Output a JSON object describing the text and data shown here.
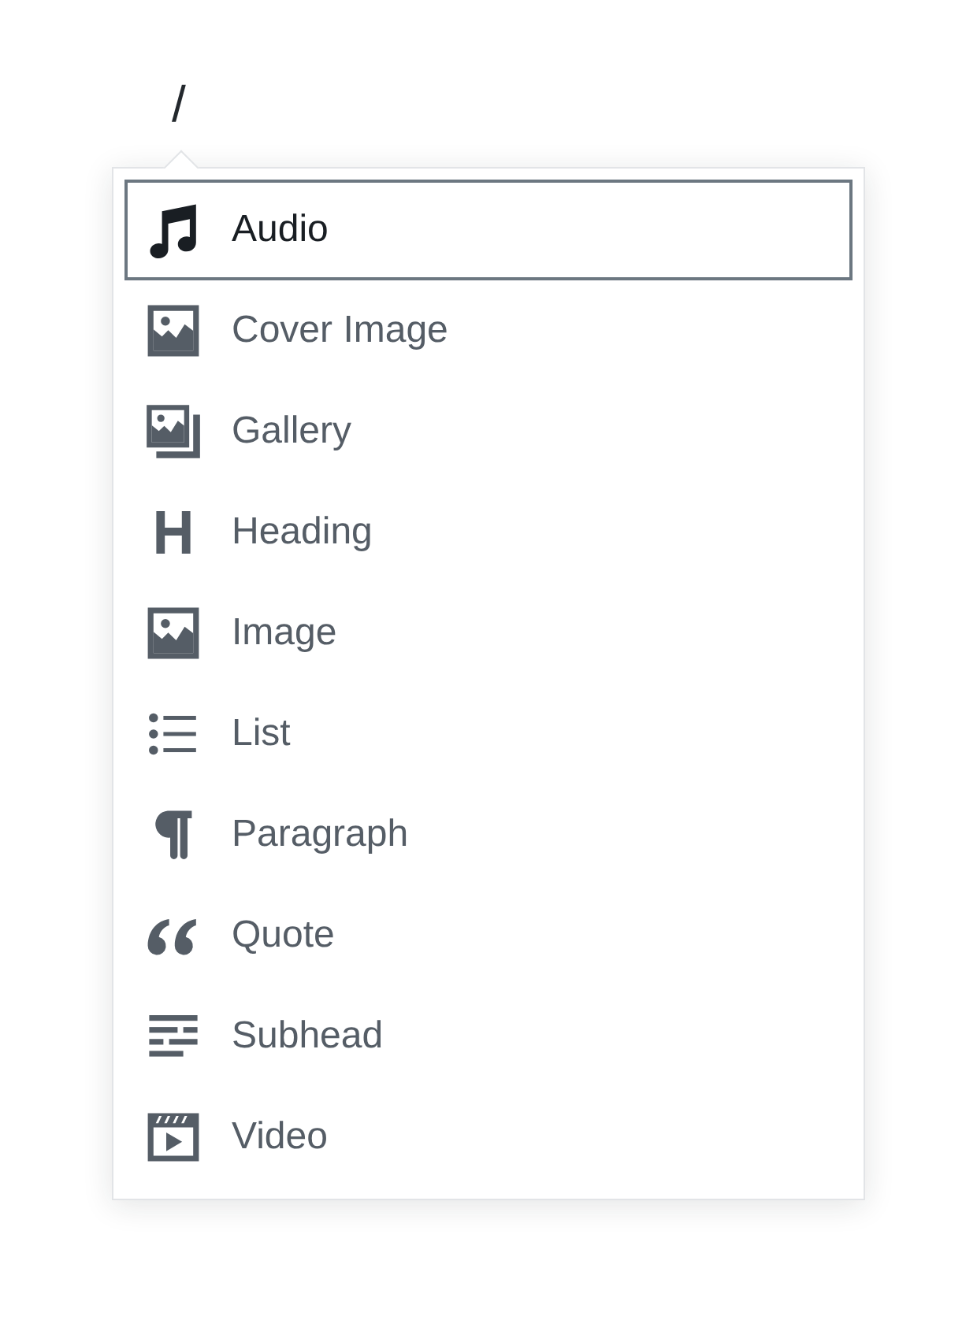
{
  "editor": {
    "typed_text": "/"
  },
  "block_menu": {
    "items": [
      {
        "label": "Audio",
        "kind": "audio",
        "selected": true
      },
      {
        "label": "Cover Image",
        "kind": "image",
        "selected": false
      },
      {
        "label": "Gallery",
        "kind": "gallery",
        "selected": false
      },
      {
        "label": "Heading",
        "kind": "heading",
        "selected": false
      },
      {
        "label": "Image",
        "kind": "image",
        "selected": false
      },
      {
        "label": "List",
        "kind": "list",
        "selected": false
      },
      {
        "label": "Paragraph",
        "kind": "paragraph",
        "selected": false
      },
      {
        "label": "Quote",
        "kind": "quote",
        "selected": false
      },
      {
        "label": "Subhead",
        "kind": "subhead",
        "selected": false
      },
      {
        "label": "Video",
        "kind": "video",
        "selected": false
      }
    ]
  }
}
